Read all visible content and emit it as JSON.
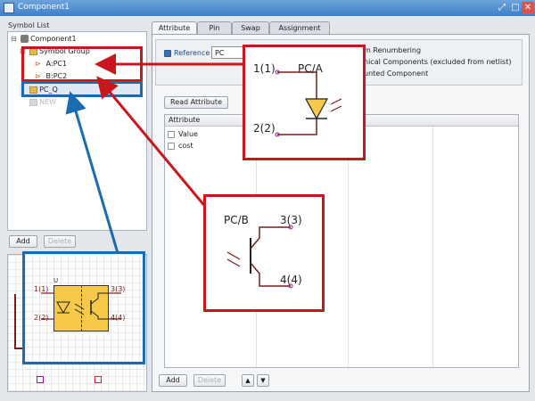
{
  "window": {
    "title": "Component1"
  },
  "left": {
    "symbol_list_label": "Symbol List",
    "tree": [
      {
        "label": "Component1"
      },
      {
        "label": "Symbol Group"
      },
      {
        "label": "A:PC1"
      },
      {
        "label": "B:PC2"
      },
      {
        "label": "PC_Q"
      },
      {
        "label": "NEW"
      }
    ],
    "add_label": "Add",
    "delete_label": "Delete"
  },
  "tabs": [
    {
      "label": "Attribute"
    },
    {
      "label": "Pin"
    },
    {
      "label": "Swap"
    },
    {
      "label": "Assignment"
    }
  ],
  "attribute": {
    "reference_label": "Reference",
    "reference_value": "PC",
    "options": [
      "m Renumbering",
      "nical Components (excluded from netlist)",
      "unted Component"
    ],
    "read_attribute_label": "Read Attribute",
    "grid_header": "Attribute",
    "rows": [
      {
        "label": "Value"
      },
      {
        "label": "cost"
      }
    ],
    "add_label": "Add",
    "delete_label": "Delete",
    "up_label": "▲",
    "down_label": "▼"
  },
  "callout_a": {
    "pin1": "1(1)",
    "pin2": "2(2)",
    "name": "PC/A"
  },
  "callout_b": {
    "name": "PC/B",
    "pin3": "3(3)",
    "pin4": "4(4)"
  },
  "callout_q": {
    "ref": "U",
    "pin1": "1(1)",
    "pin2": "2(2)",
    "pin3": "3(3)",
    "pin4": "4(4)"
  },
  "colors": {
    "callout_red": "#c8161d",
    "callout_blue": "#1a6bb0",
    "titlebar": "#3f7fc6",
    "symbol_fill": "#f6c94a"
  }
}
